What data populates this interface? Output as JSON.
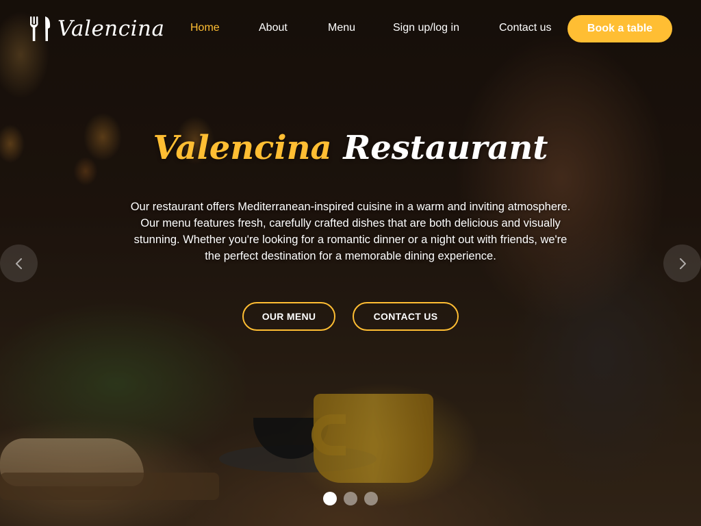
{
  "brand": {
    "name": "Valencina",
    "logo_icon": "fork-knife-icon"
  },
  "nav": {
    "items": [
      {
        "label": "Home",
        "active": true
      },
      {
        "label": "About",
        "active": false
      },
      {
        "label": "Menu",
        "active": false
      },
      {
        "label": "Sign up/log in",
        "active": false
      },
      {
        "label": "Contact us",
        "active": false
      }
    ],
    "cta_label": "Book a table"
  },
  "hero": {
    "title_accent": "Valencina",
    "title_rest": "Restaurant",
    "description": "Our restaurant offers Mediterranean-inspired cuisine in a warm and inviting atmosphere. Our menu features fresh, carefully crafted dishes that are both delicious and visually stunning. Whether you're looking for a romantic dinner or a night out with friends, we're the perfect destination for a memorable dining experience.",
    "buttons": {
      "menu_label": "OUR MENU",
      "contact_label": "CONTACT US"
    }
  },
  "carousel": {
    "prev_icon": "chevron-left-icon",
    "next_icon": "chevron-right-icon",
    "slide_count": 3,
    "active_slide": 1
  },
  "colors": {
    "accent": "#ffbe33",
    "text": "#ffffff"
  }
}
